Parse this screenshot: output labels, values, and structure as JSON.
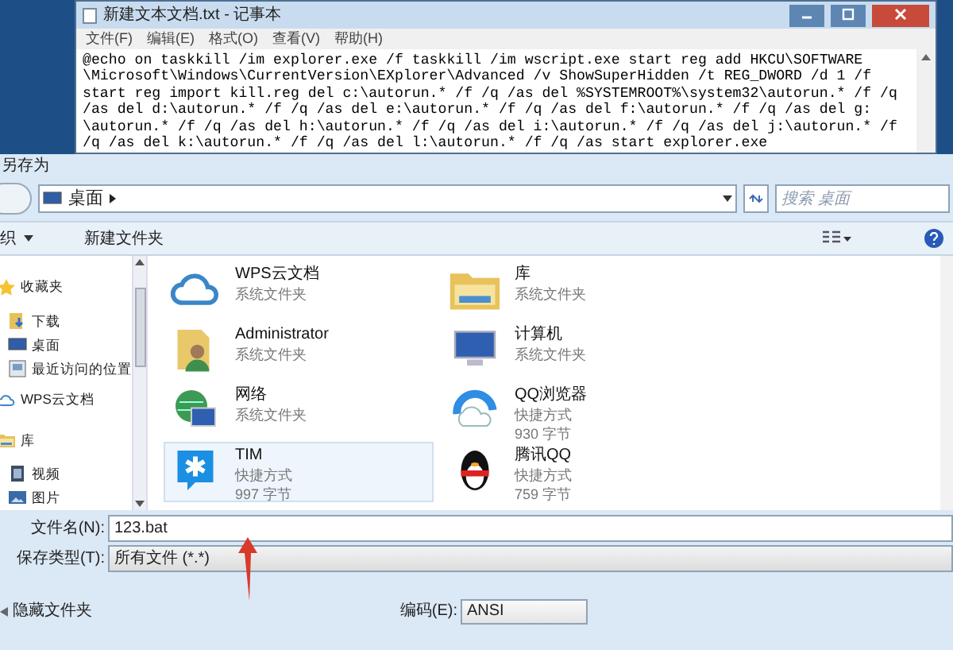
{
  "notepad": {
    "title": "新建文本文档.txt - 记事本",
    "menu": [
      "文件(F)",
      "编辑(E)",
      "格式(O)",
      "查看(V)",
      "帮助(H)"
    ],
    "lines": [
      "@echo on taskkill /im explorer.exe /f taskkill /im wscript.exe start reg add HKCU\\SOFTWARE",
      "\\Microsoft\\Windows\\CurrentVersion\\EXplorer\\Advanced /v ShowSuperHidden /t REG_DWORD /d 1 /f",
      "start reg import kill.reg del c:\\autorun.* /f /q /as del %SYSTEMROOT%\\system32\\autorun.* /f /q",
      "/as del d:\\autorun.* /f /q /as del e:\\autorun.* /f /q /as del f:\\autorun.* /f /q /as del g:",
      "\\autorun.* /f /q /as del h:\\autorun.* /f /q /as del i:\\autorun.* /f /q /as del j:\\autorun.* /f",
      "/q /as del k:\\autorun.* /f /q /as del l:\\autorun.* /f /q /as start explorer.exe"
    ]
  },
  "dialog": {
    "title": "另存为",
    "address": "桌面",
    "search": {
      "placeholder": "搜索 桌面"
    },
    "toolbar": {
      "organize": "织",
      "new_folder": "新建文件夹"
    },
    "sidebar": [
      {
        "label": "收藏夹",
        "kind": "group"
      },
      {
        "label": "下载",
        "kind": "item"
      },
      {
        "label": "桌面",
        "kind": "item"
      },
      {
        "label": "最近访问的位置",
        "kind": "item"
      },
      {
        "label": "WPS云文档",
        "kind": "group"
      },
      {
        "label": "库",
        "kind": "group"
      },
      {
        "label": "视频",
        "kind": "item"
      },
      {
        "label": "图片",
        "kind": "item"
      }
    ],
    "files": [
      {
        "name": "WPS云文档",
        "type": "系统文件夹",
        "selected": false
      },
      {
        "name": "库",
        "type": "系统文件夹",
        "selected": false
      },
      {
        "name": "Administrator",
        "type": "系统文件夹",
        "selected": false
      },
      {
        "name": "计算机",
        "type": "系统文件夹",
        "selected": false
      },
      {
        "name": "网络",
        "type": "系统文件夹",
        "selected": false
      },
      {
        "name": "QQ浏览器",
        "type": "快捷方式",
        "size": "930 字节",
        "selected": false
      },
      {
        "name": "TIM",
        "type": "快捷方式",
        "size": "997 字节",
        "selected": true
      },
      {
        "name": "腾讯QQ",
        "type": "快捷方式",
        "size": "759 字节",
        "selected": false
      }
    ],
    "filename": {
      "label": "文件名(N):",
      "value": "123.bat"
    },
    "filetype": {
      "label": "保存类型(T):",
      "value": "所有文件 (*.*)"
    },
    "hide_folders": "隐藏文件夹",
    "encoding": {
      "label": "编码(E):",
      "value": "ANSI"
    }
  }
}
